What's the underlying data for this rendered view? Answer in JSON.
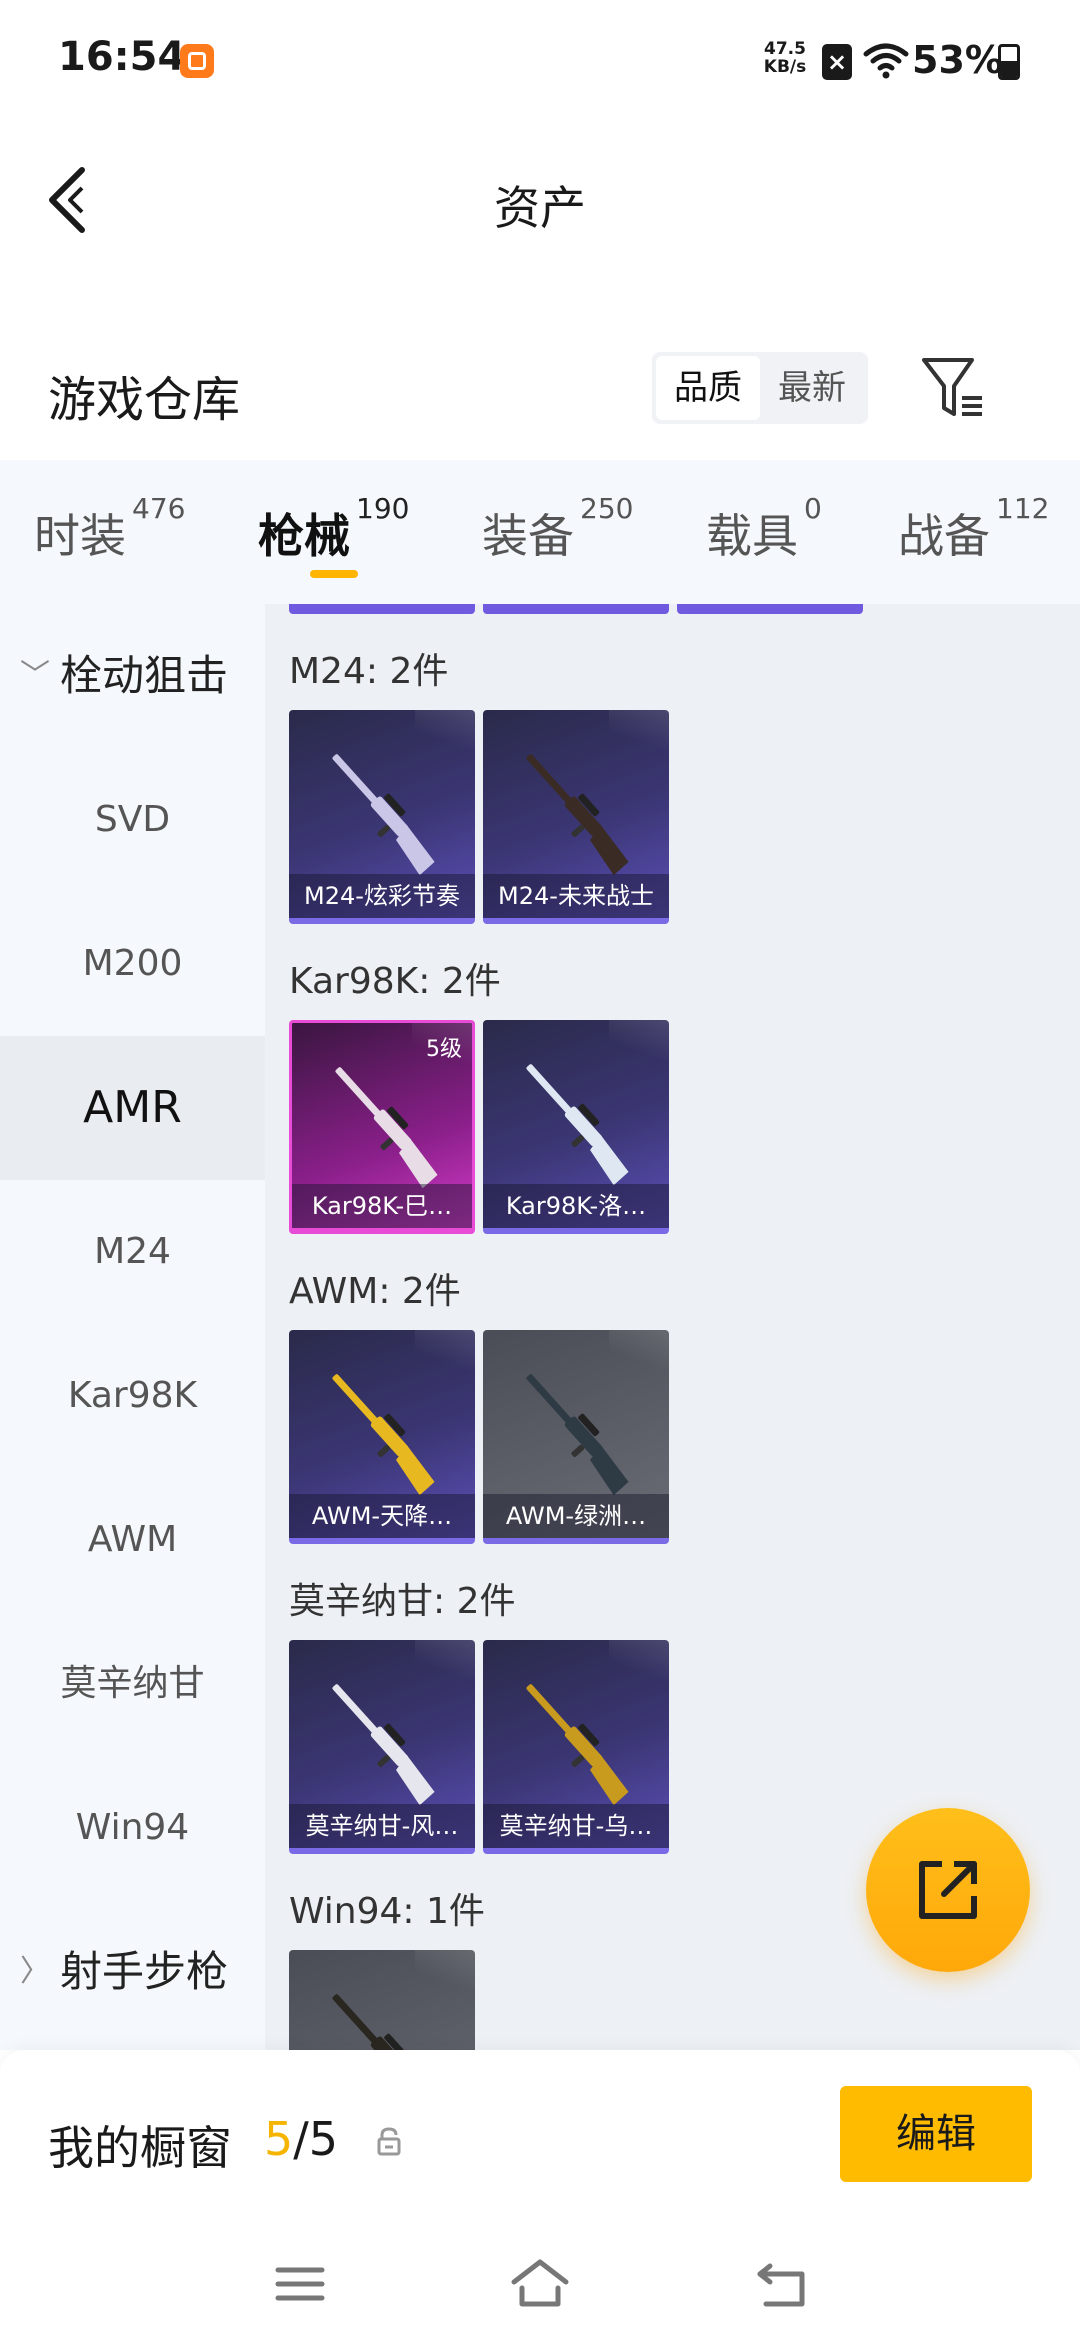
{
  "status_bar": {
    "time": "16:54",
    "net_speed_value": "47.5",
    "net_speed_unit": "KB/s",
    "battery_text": "53%",
    "battery_level": 0.53
  },
  "nav": {
    "title": "资产"
  },
  "warehouse": {
    "title": "游戏仓库",
    "sort_quality": "品质",
    "sort_newest": "最新"
  },
  "tabs": [
    {
      "label": "时装",
      "count": "476"
    },
    {
      "label": "枪械",
      "count": "190"
    },
    {
      "label": "装备",
      "count": "250"
    },
    {
      "label": "载具",
      "count": "0"
    },
    {
      "label": "战备",
      "count": "112"
    }
  ],
  "sidebar": {
    "group1": "栓动狙击",
    "items": [
      "SVD",
      "M200",
      "AMR",
      "M24",
      "Kar98K",
      "AWM",
      "莫辛纳甘",
      "Win94"
    ],
    "group2": "射手步枪"
  },
  "groups": [
    {
      "title": "M24: 2件",
      "cards": [
        {
          "label": "M24-炫彩节奏",
          "style": "blue",
          "gun_color": "#c9c6e8",
          "level": ""
        },
        {
          "label": "M24-未来战士",
          "style": "blue",
          "gun_color": "#3a2c24",
          "level": ""
        }
      ]
    },
    {
      "title": "Kar98K: 2件",
      "cards": [
        {
          "label": "Kar98K-巳…",
          "style": "pink",
          "gun_color": "#e8dde6",
          "level": "5级"
        },
        {
          "label": "Kar98K-洛…",
          "style": "blue",
          "gun_color": "#dfe8f2",
          "level": ""
        }
      ]
    },
    {
      "title": "AWM: 2件",
      "cards": [
        {
          "label": "AWM-天降…",
          "style": "blue",
          "gun_color": "#e8b820",
          "level": ""
        },
        {
          "label": "AWM-绿洲…",
          "style": "gray",
          "gun_color": "#2e3a44",
          "level": ""
        }
      ]
    },
    {
      "title": "莫辛纳甘: 2件",
      "cards": [
        {
          "label": "莫辛纳甘-风…",
          "style": "blue",
          "gun_color": "#e6e6ee",
          "level": ""
        },
        {
          "label": "莫辛纳甘-乌…",
          "style": "blue",
          "gun_color": "#c89a1e",
          "level": ""
        }
      ]
    },
    {
      "title": "Win94: 1件",
      "cards": [
        {
          "label": "",
          "style": "gray",
          "gun_color": "#2a2620",
          "level": ""
        }
      ]
    }
  ],
  "showcase": {
    "label": "我的橱窗",
    "current": "5",
    "separator_total": "/5",
    "edit_label": "编辑"
  },
  "colors": {
    "accent": "#ffbb00",
    "tab_indicator": "#ffb400",
    "card_border": "#7a6ae6"
  }
}
